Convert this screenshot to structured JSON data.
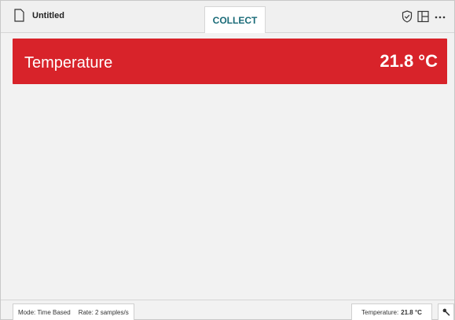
{
  "header": {
    "file_title": "Untitled",
    "active_tab": "COLLECT",
    "icons": [
      "file-icon",
      "shield-check-icon",
      "layout-icon",
      "more-icon"
    ]
  },
  "meter": {
    "label": "Temperature",
    "value": "21.8 °C",
    "color": "#d8232a"
  },
  "status": {
    "mode": "Mode: Time Based",
    "rate": "Rate: 2 samples/s",
    "sensor_label": "Temperature:",
    "sensor_value": "21.8 °C"
  },
  "colors": {
    "accent": "#1a6b78",
    "meter_red": "#d8232a"
  }
}
